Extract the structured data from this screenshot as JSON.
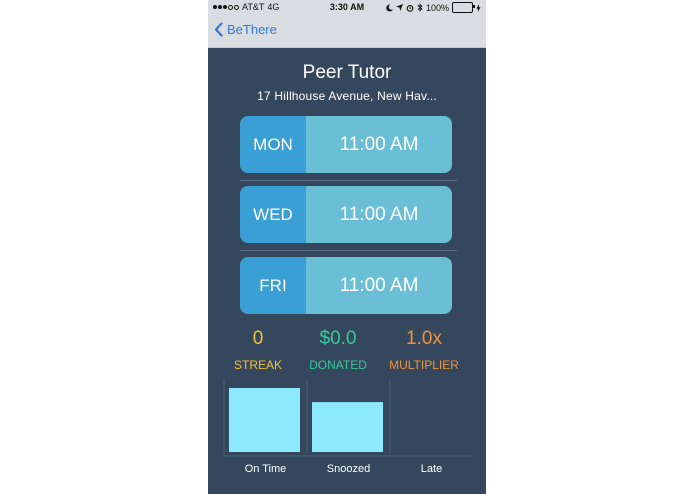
{
  "status_bar": {
    "carrier": "AT&T",
    "network": "4G",
    "time": "3:30 AM",
    "battery": "100%",
    "icons": [
      "moon-icon",
      "location-arrow-icon",
      "alarm-icon",
      "bluetooth-icon",
      "charging-bolt-icon"
    ]
  },
  "nav": {
    "back_label": "BeThere"
  },
  "event": {
    "title": "Peer Tutor",
    "address": "17 Hillhouse Avenue, New Hav..."
  },
  "schedule": [
    {
      "day": "MON",
      "time": "11:00 AM"
    },
    {
      "day": "WED",
      "time": "11:00 AM"
    },
    {
      "day": "FRI",
      "time": "11:00 AM"
    }
  ],
  "stats": [
    {
      "value": "0",
      "label": "STREAK",
      "color": "#f2c13b"
    },
    {
      "value": "$0.0",
      "label": "DONATED",
      "color": "#37c99a"
    },
    {
      "value": "1.0x",
      "label": "MULTIPLIER",
      "color": "#f0923a"
    }
  ],
  "colors": {
    "background": "#34475c",
    "day_label_bg": "#3a9fd4",
    "time_bg": "#6abfd6",
    "bar_fill": "#8ce9ff",
    "link": "#2f7ad9"
  },
  "chart_data": {
    "type": "bar",
    "categories": [
      "On Time",
      "Snoozed",
      "Late"
    ],
    "values": [
      1.0,
      0.78,
      0
    ],
    "ylim": [
      0,
      1
    ],
    "title": "",
    "xlabel": "",
    "ylabel": "",
    "grid": true
  }
}
